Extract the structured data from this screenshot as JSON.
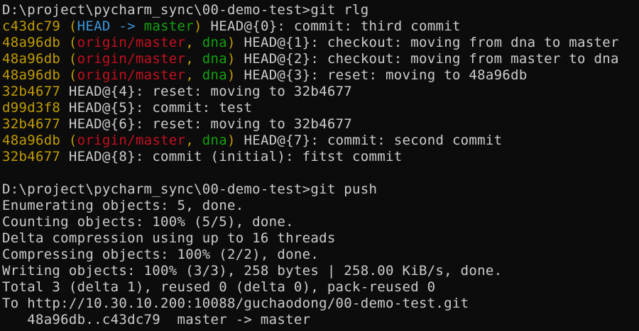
{
  "colors": {
    "background": "#0c0c0c",
    "text": "#cccccc",
    "hash": "#c19c00",
    "head": "#3a96dd",
    "local_branch": "#13a10e",
    "remote_branch": "#c50f1f"
  },
  "prompt1": {
    "path": "D:\\project\\pycharm_sync\\00-demo-test>",
    "command": "git rlg"
  },
  "reflog": [
    {
      "hash": "c43dc79",
      "open": " (",
      "refs": [
        {
          "t": "HEAD -> ",
          "c": "head"
        },
        {
          "t": "master",
          "c": "local"
        }
      ],
      "close": ")",
      "rest": " HEAD@{0}: commit: third commit"
    },
    {
      "hash": "48a96db",
      "open": " (",
      "refs": [
        {
          "t": "origin/master",
          "c": "remote"
        },
        {
          "t": ", ",
          "c": "paren"
        },
        {
          "t": "dna",
          "c": "local"
        }
      ],
      "close": ")",
      "rest": " HEAD@{1}: checkout: moving from dna to master"
    },
    {
      "hash": "48a96db",
      "open": " (",
      "refs": [
        {
          "t": "origin/master",
          "c": "remote"
        },
        {
          "t": ", ",
          "c": "paren"
        },
        {
          "t": "dna",
          "c": "local"
        }
      ],
      "close": ")",
      "rest": " HEAD@{2}: checkout: moving from master to dna"
    },
    {
      "hash": "48a96db",
      "open": " (",
      "refs": [
        {
          "t": "origin/master",
          "c": "remote"
        },
        {
          "t": ", ",
          "c": "paren"
        },
        {
          "t": "dna",
          "c": "local"
        }
      ],
      "close": ")",
      "rest": " HEAD@{3}: reset: moving to 48a96db"
    },
    {
      "hash": "32b4677",
      "open": "",
      "refs": [],
      "close": "",
      "rest": " HEAD@{4}: reset: moving to 32b4677"
    },
    {
      "hash": "d99d3f8",
      "open": "",
      "refs": [],
      "close": "",
      "rest": " HEAD@{5}: commit: test"
    },
    {
      "hash": "32b4677",
      "open": "",
      "refs": [],
      "close": "",
      "rest": " HEAD@{6}: reset: moving to 32b4677"
    },
    {
      "hash": "48a96db",
      "open": " (",
      "refs": [
        {
          "t": "origin/master",
          "c": "remote"
        },
        {
          "t": ", ",
          "c": "paren"
        },
        {
          "t": "dna",
          "c": "local"
        }
      ],
      "close": ")",
      "rest": " HEAD@{7}: commit: second commit"
    },
    {
      "hash": "32b4677",
      "open": "",
      "refs": [],
      "close": "",
      "rest": " HEAD@{8}: commit (initial): fitst commit"
    }
  ],
  "prompt2": {
    "path": "D:\\project\\pycharm_sync\\00-demo-test>",
    "command": "git push"
  },
  "push_output": [
    "Enumerating objects: 5, done.",
    "Counting objects: 100% (5/5), done.",
    "Delta compression using up to 16 threads",
    "Compressing objects: 100% (2/2), done.",
    "Writing objects: 100% (3/3), 258 bytes | 258.00 KiB/s, done.",
    "Total 3 (delta 1), reused 0 (delta 0), pack-reused 0",
    "To http://10.30.10.200:10088/guchaodong/00-demo-test.git",
    "   48a96db..c43dc79  master -> master"
  ]
}
